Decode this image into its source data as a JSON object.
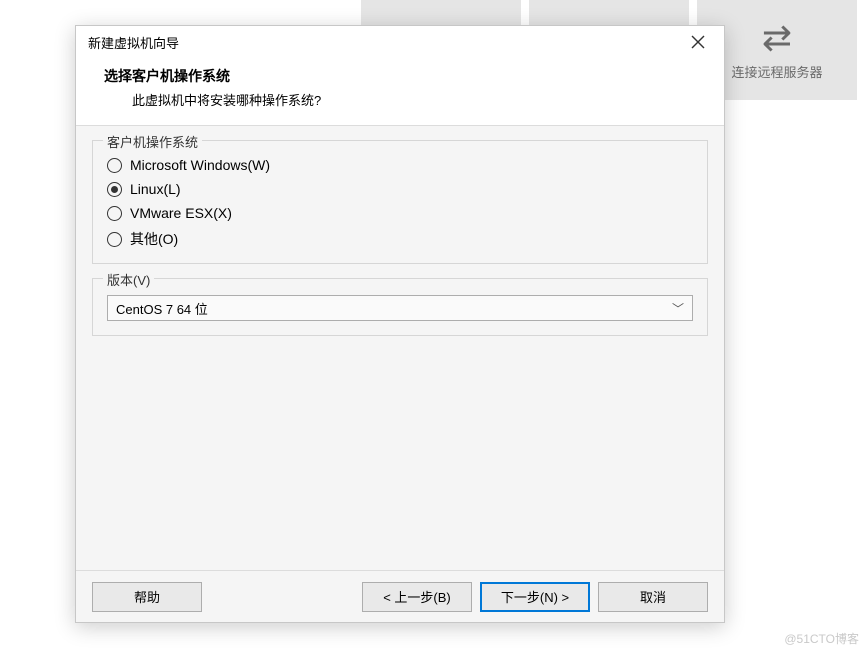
{
  "background": {
    "tiles": [
      {
        "icon": "plus",
        "label": ""
      },
      {
        "icon": "edit",
        "label": ""
      },
      {
        "icon": "swap",
        "label": "连接远程服务器"
      }
    ]
  },
  "dialog": {
    "title": "新建虚拟机向导",
    "header": {
      "heading": "选择客户机操作系统",
      "subheading": "此虚拟机中将安装哪种操作系统?"
    },
    "os_group": {
      "legend": "客户机操作系统",
      "options": [
        {
          "label": "Microsoft Windows(W)",
          "selected": false
        },
        {
          "label": "Linux(L)",
          "selected": true
        },
        {
          "label": "VMware ESX(X)",
          "selected": false
        },
        {
          "label": "其他(O)",
          "selected": false
        }
      ]
    },
    "version_group": {
      "legend": "版本(V)",
      "selected": "CentOS 7 64 位"
    },
    "buttons": {
      "help": "帮助",
      "back": "< 上一步(B)",
      "next": "下一步(N) >",
      "cancel": "取消"
    }
  },
  "watermark": "@51CTO博客"
}
